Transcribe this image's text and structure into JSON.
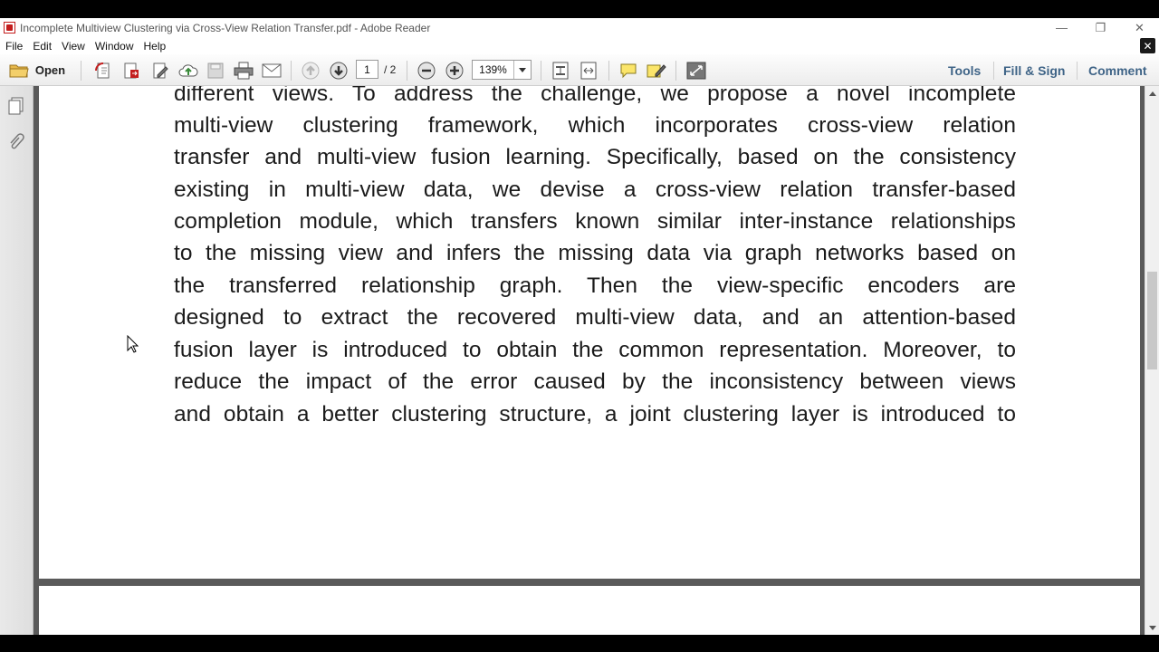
{
  "window": {
    "title": "Incomplete Multiview Clustering via Cross-View Relation Transfer.pdf - Adobe Reader",
    "minimize": "—",
    "restore": "❐",
    "close": "✕"
  },
  "menu": {
    "items": [
      "File",
      "Edit",
      "View",
      "Window",
      "Help"
    ],
    "close": "✕"
  },
  "toolbar": {
    "open_label": "Open",
    "page_current": "1",
    "page_total": "/ 2",
    "zoom": "139%",
    "tools_label": "Tools",
    "fill_sign_label": "Fill & Sign",
    "comment_label": "Comment"
  },
  "colors": {
    "accent_link": "#3f6487",
    "document_background": "#5a5a5a"
  },
  "document": {
    "lines": [
      "different views. To address the challenge, we propose a novel incomplete",
      "multi-view clustering framework, which incorporates cross-view relation",
      "transfer and multi-view fusion learning. Specifically, based on the consistency",
      "existing in multi-view data, we devise a cross-view relation transfer-based",
      "completion module, which transfers known similar inter-instance relationships",
      "to the missing view and infers the missing data via graph networks based on",
      "the transferred relationship graph. Then the view-specific encoders are",
      "designed to extract the recovered multi-view data, and an attention-based",
      "fusion layer is introduced to obtain the common representation. Moreover, to",
      "reduce the impact of the error caused by the inconsistency between views",
      "and obtain a better clustering structure, a joint clustering layer is introduced to"
    ]
  }
}
